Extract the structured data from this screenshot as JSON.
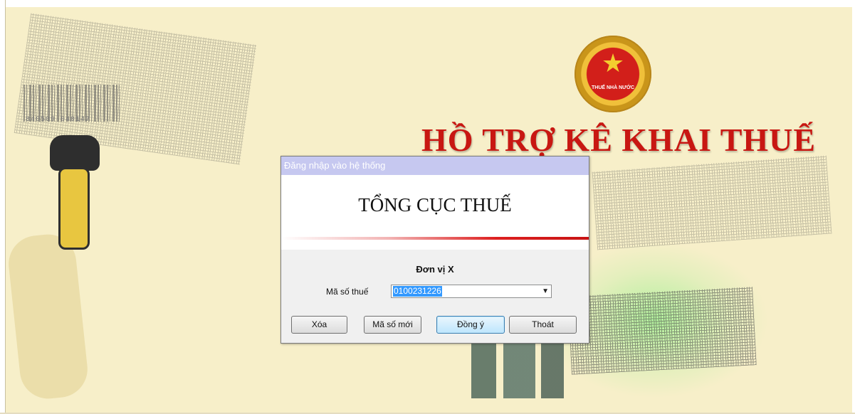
{
  "app": {
    "title": "HỒ TRỢ KÊ KHAI THUẾ",
    "emblem_text": "THUẾ NHÀ NƯỚC",
    "barcode_digits": "840509 040147"
  },
  "dialog": {
    "title": "Đăng nhập vào hệ thống",
    "banner_title": "TỔNG CỤC THUẾ",
    "unit_name": "Đơn vị X",
    "tax_code": {
      "label": "Mã số thuế",
      "value": "0100231226"
    },
    "buttons": {
      "clear": "Xóa",
      "new_code": "Mã số mới",
      "ok": "Đồng ý",
      "exit": "Thoát"
    }
  },
  "colors": {
    "background": "#f7efc9",
    "title_red": "#c81712",
    "titlebar": "#c6c8f0",
    "selection": "#3399ff"
  },
  "icons": [
    "national-tax-emblem-icon",
    "barcode-scanner-icon",
    "chevron-down-icon"
  ]
}
